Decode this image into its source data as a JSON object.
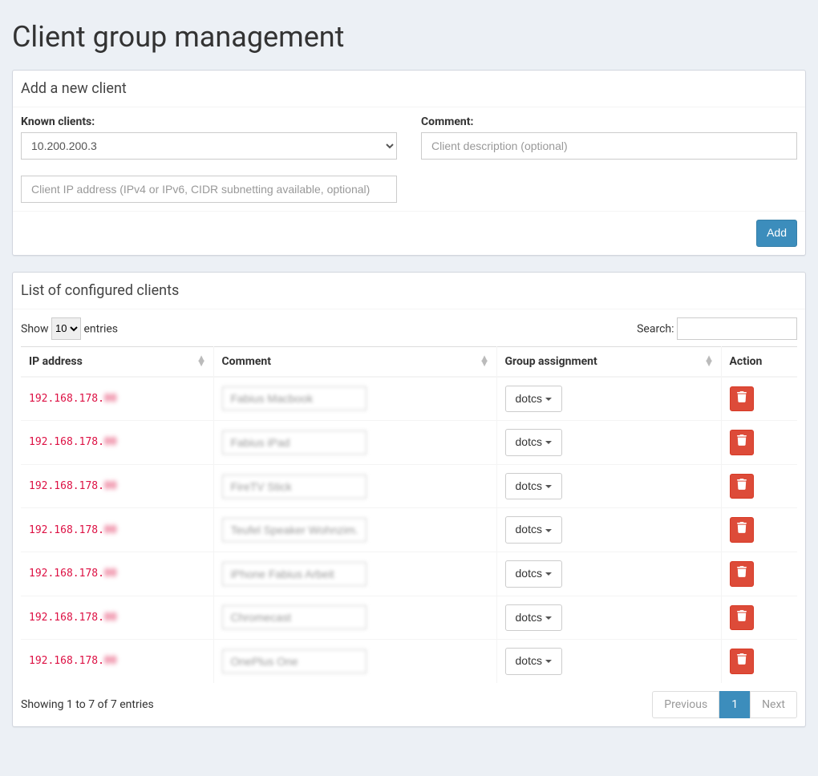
{
  "page_title": "Client group management",
  "add_box": {
    "title": "Add a new client",
    "known_label": "Known clients:",
    "known_value": "10.200.200.3",
    "comment_label": "Comment:",
    "comment_placeholder": "Client description (optional)",
    "ip_placeholder": "Client IP address (IPv4 or IPv6, CIDR subnetting available, optional)",
    "add_label": "Add"
  },
  "list_box": {
    "title": "List of configured clients",
    "show_label_pre": "Show",
    "show_label_post": "entries",
    "length_value": "10",
    "search_label": "Search:",
    "headers": {
      "ip": "IP address",
      "comment": "Comment",
      "group": "Group assignment",
      "action": "Action"
    },
    "rows": [
      {
        "ip_prefix": "192.168.178.",
        "ip_suffix": "00",
        "comment": "Fabius Macbook",
        "group": "dotcs"
      },
      {
        "ip_prefix": "192.168.178.",
        "ip_suffix": "00",
        "comment": "Fabius iPad",
        "group": "dotcs"
      },
      {
        "ip_prefix": "192.168.178.",
        "ip_suffix": "00",
        "comment": "FireTV Stick",
        "group": "dotcs"
      },
      {
        "ip_prefix": "192.168.178.",
        "ip_suffix": "00",
        "comment": "Teufel Speaker Wohnzim.",
        "group": "dotcs"
      },
      {
        "ip_prefix": "192.168.178.",
        "ip_suffix": "00",
        "comment": "iPhone Fabius Arbeit",
        "group": "dotcs"
      },
      {
        "ip_prefix": "192.168.178.",
        "ip_suffix": "00",
        "comment": "Chromecast",
        "group": "dotcs"
      },
      {
        "ip_prefix": "192.168.178.",
        "ip_suffix": "00",
        "comment": "OnePlus One",
        "group": "dotcs"
      }
    ],
    "info_text": "Showing 1 to 7 of 7 entries",
    "prev_label": "Previous",
    "page_label": "1",
    "next_label": "Next"
  }
}
